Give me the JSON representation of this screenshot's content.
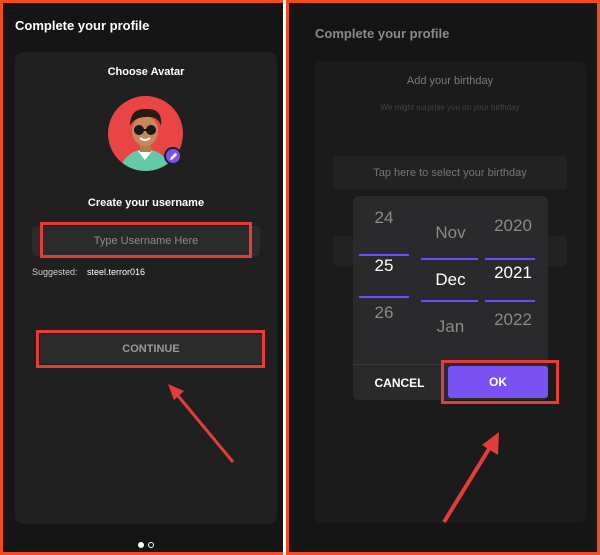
{
  "left_screen": {
    "title": "Complete your profile",
    "avatar_label": "Choose Avatar",
    "username_label": "Create your username",
    "username_placeholder": "Type Username Here",
    "suggested_label": "Suggested:",
    "suggested_value": "steel.terror016",
    "continue_label": "CONTINUE"
  },
  "right_screen": {
    "title": "Complete your profile",
    "birthday_heading": "Add your birthday",
    "birthday_subtext": "We might surprise you on your birthday",
    "birthday_field": "Tap here to select your birthday",
    "picker": {
      "days": [
        "24",
        "25",
        "26"
      ],
      "months": [
        "Nov",
        "Dec",
        "Jan"
      ],
      "years": [
        "2020",
        "2021",
        "2022"
      ],
      "selected": {
        "day": "25",
        "month": "Dec",
        "year": "2021"
      }
    },
    "cancel_label": "CANCEL",
    "ok_label": "OK"
  },
  "colors": {
    "accent": "#7a52f3",
    "highlight_frame": "#e53b3b",
    "outer_frame": "#f24b1f",
    "background": "#151515"
  }
}
